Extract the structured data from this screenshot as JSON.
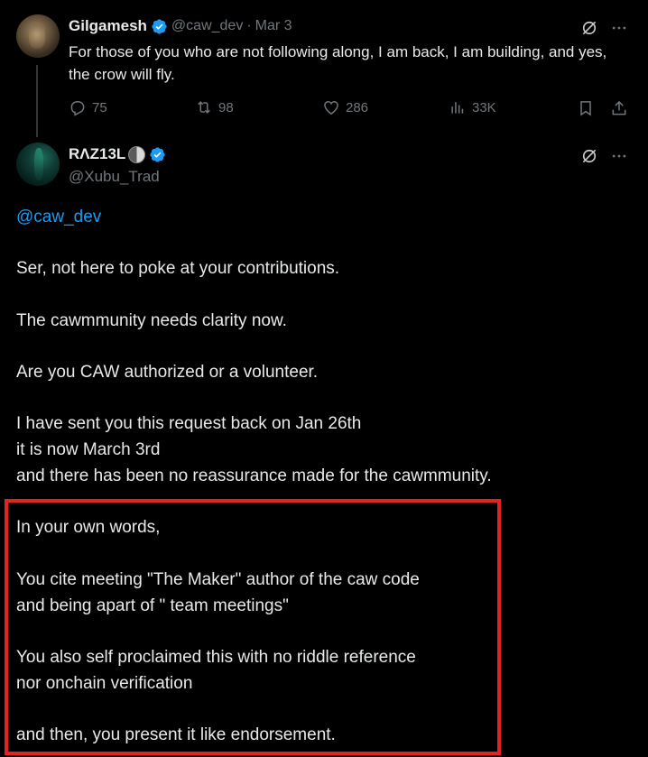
{
  "parent_tweet": {
    "display_name": "Gilgamesh",
    "handle": "@caw_dev",
    "separator": "·",
    "date": "Mar 3",
    "text": "For those of you who are not following along, I am back, I am building, and yes, the crow will fly.",
    "stats": {
      "replies": "75",
      "reposts": "98",
      "likes": "286",
      "views": "33K"
    }
  },
  "reply_tweet": {
    "display_name": "RΛZ13L",
    "handle": "@Xubu_Trad",
    "mention": "@caw_dev",
    "lines": [
      "Ser, not here to poke at your contributions.",
      "The cawmmunity needs clarity now.",
      "Are you CAW authorized or a volunteer.",
      "I have sent you this request back on Jan 26th",
      "it is now March 3rd",
      "and there has been no reassurance made for the cawmmunity.",
      "In your own words,",
      "You cite meeting \"The Maker\" author of the caw code",
      "and being apart of \" team meetings\"",
      "You also self proclaimed this with no riddle reference",
      "nor onchain verification",
      "and then, you present it like endorsement."
    ]
  },
  "colors": {
    "background": "#000000",
    "text": "#e7e9ea",
    "muted": "#71767b",
    "accent": "#1d9bf0",
    "highlight": "#e52222"
  },
  "icons": [
    "verified-badge-icon",
    "grok-icon",
    "more-icon",
    "reply-icon",
    "repost-icon",
    "like-icon",
    "views-icon",
    "bookmark-icon",
    "share-icon",
    "moon-emoji-icon"
  ]
}
